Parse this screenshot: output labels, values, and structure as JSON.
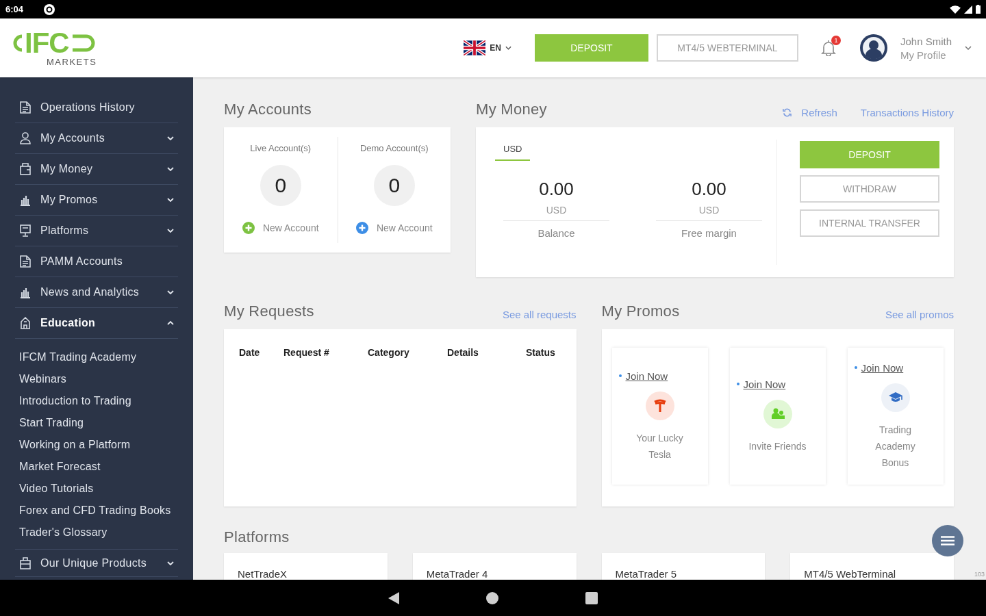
{
  "status_bar": {
    "time": "6:04"
  },
  "header": {
    "logo": {
      "mark": "IFC",
      "caption": "MARKETS"
    },
    "language": "EN",
    "buttons": [
      {
        "label": "DEPOSIT",
        "kind": "primary"
      },
      {
        "label": "MT4/5 WEBTERMINAL",
        "kind": "outline"
      }
    ],
    "notification_count": "1",
    "user": {
      "name": "John Smith",
      "link": "My Profile"
    }
  },
  "sidebar": {
    "items": [
      {
        "label": "Operations History",
        "kind": "link"
      },
      {
        "label": "My Accounts",
        "kind": "group",
        "expanded": false
      },
      {
        "label": "My Money",
        "kind": "group",
        "expanded": false
      },
      {
        "label": "My Promos",
        "kind": "group",
        "expanded": false
      },
      {
        "label": "Platforms",
        "kind": "group",
        "expanded": false
      },
      {
        "label": "PAMM Accounts",
        "kind": "link"
      },
      {
        "label": "News and Analytics",
        "kind": "group",
        "expanded": false
      },
      {
        "label": "Education",
        "kind": "group",
        "expanded": true,
        "children": [
          {
            "label": "IFCM Trading Academy"
          },
          {
            "label": "Webinars"
          },
          {
            "label": "Introduction to Trading"
          },
          {
            "label": "Start Trading"
          },
          {
            "label": "Working on a Platform"
          },
          {
            "label": "Market Forecast"
          },
          {
            "label": "Video Tutorials"
          },
          {
            "label": "Forex and CFD Trading Books"
          },
          {
            "label": "Trader's Glossary"
          }
        ]
      },
      {
        "label": "Our Unique Products",
        "kind": "group",
        "expanded": false
      }
    ]
  },
  "my_accounts": {
    "title": "My Accounts",
    "columns": [
      {
        "label": "Live Account(s)",
        "count": "0",
        "action": "New Account",
        "color": "#7dc242"
      },
      {
        "label": "Demo Account(s)",
        "count": "0",
        "action": "New Account",
        "color": "#3d8ee6"
      }
    ]
  },
  "my_money": {
    "title": "My Money",
    "links": [
      {
        "label": "Refresh",
        "kind": "refresh"
      },
      {
        "label": "Transactions History",
        "kind": "plain"
      }
    ],
    "currency_tabs": [
      {
        "label": "USD",
        "selected": true
      }
    ],
    "values": [
      {
        "amount": "0.00",
        "currency": "USD",
        "label": "Balance"
      },
      {
        "amount": "0.00",
        "currency": "USD",
        "label": "Free margin"
      }
    ],
    "buttons": [
      {
        "label": "DEPOSIT",
        "kind": "primary"
      },
      {
        "label": "WITHDRAW",
        "kind": "outline"
      },
      {
        "label": "INTERNAL TRANSFER",
        "kind": "outline"
      }
    ]
  },
  "my_requests": {
    "title": "My Requests",
    "link": "See all requests",
    "columns": [
      "Date",
      "Request #",
      "Category",
      "Details",
      "Status"
    ]
  },
  "my_promos": {
    "title": "My Promos",
    "link": "See all promos",
    "promos": [
      {
        "action": "Join Now",
        "name": "Your Lucky Tesla",
        "color": "#fde3dc"
      },
      {
        "action": "Join Now",
        "name": "Invite Friends",
        "color": "#e1f7d5"
      },
      {
        "action": "Join Now",
        "name": "Trading Academy Bonus",
        "color": "#edf1f7"
      }
    ]
  },
  "platforms": {
    "title": "Platforms",
    "cards": [
      "NetTradeX",
      "MetaTrader 4",
      "MetaTrader 5",
      "MT4/5 WebTerminal"
    ],
    "edge_text": "103"
  }
}
